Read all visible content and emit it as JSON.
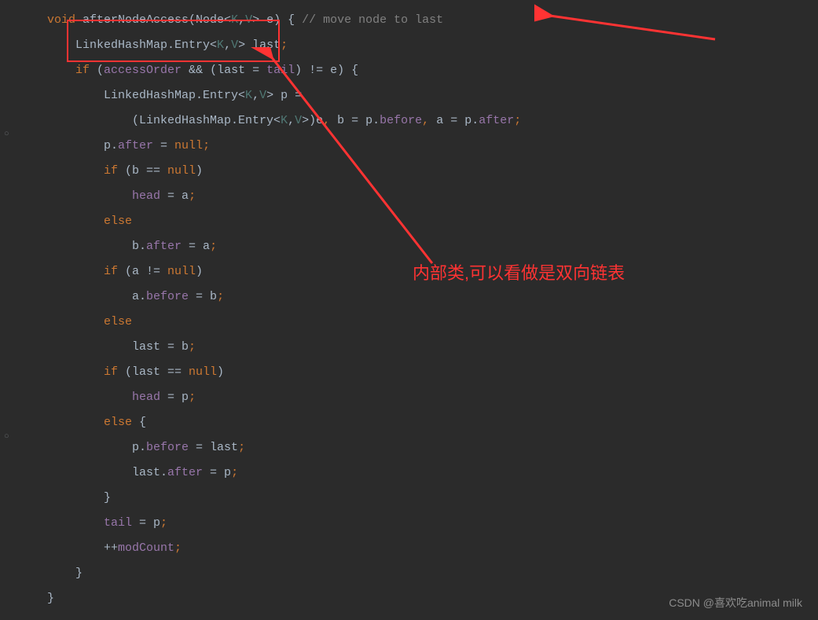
{
  "code": {
    "l1_kw": "void",
    "l1_name": " afterNodeAccess(Node<",
    "l1_g1": "K",
    "l1_c1": ",",
    "l1_g2": "V",
    "l1_rest": "> e) { ",
    "l1_comment": "// move node to last",
    "l2_a": "    LinkedHashMap.Entry<",
    "l2_g1": "K",
    "l2_c1": ",",
    "l2_g2": "V",
    "l2_b": "> last",
    "l2_semi": ";",
    "l3_if": "    if",
    "l3_a": " (",
    "l3_accessOrder": "accessOrder",
    "l3_b": " && (last = ",
    "l3_tail": "tail",
    "l3_c": ") != e) {",
    "l4_a": "        LinkedHashMap.Entry<",
    "l4_g1": "K",
    "l4_c1": ",",
    "l4_g2": "V",
    "l4_b": "> p =",
    "l5_a": "            (LinkedHashMap.Entry<",
    "l5_g1": "K",
    "l5_c1": ",",
    "l5_g2": "V",
    "l5_b": ">)e",
    "l5_c": ", ",
    "l5_d": "b = p.",
    "l5_before": "before",
    "l5_e": ", ",
    "l5_f": "a = p.",
    "l5_after": "after",
    "l5_semi": ";",
    "l6_a": "        p.",
    "l6_after": "after",
    "l6_b": " = ",
    "l6_null": "null",
    "l6_semi": ";",
    "l7_if": "        if",
    "l7_a": " (b == ",
    "l7_null": "null",
    "l7_b": ")",
    "l8_a": "            ",
    "l8_head": "head",
    "l8_b": " = a",
    "l8_semi": ";",
    "l9_else": "        else",
    "l10_a": "            b.",
    "l10_after": "after",
    "l10_b": " = a",
    "l10_semi": ";",
    "l11_if": "        if",
    "l11_a": " (a != ",
    "l11_null": "null",
    "l11_b": ")",
    "l12_a": "            a.",
    "l12_before": "before",
    "l12_b": " = b",
    "l12_semi": ";",
    "l13_else": "        else",
    "l14_a": "            last = b",
    "l14_semi": ";",
    "l15_if": "        if",
    "l15_a": " (last == ",
    "l15_null": "null",
    "l15_b": ")",
    "l16_a": "            ",
    "l16_head": "head",
    "l16_b": " = p",
    "l16_semi": ";",
    "l17_else": "        else",
    "l17_a": " {",
    "l18_a": "            p.",
    "l18_before": "before",
    "l18_b": " = last",
    "l18_semi": ";",
    "l19_a": "            last.",
    "l19_after": "after",
    "l19_b": " = p",
    "l19_semi": ";",
    "l20_a": "        }",
    "l21_a": "        ",
    "l21_tail": "tail",
    "l21_b": " = p",
    "l21_semi": ";",
    "l22_a": "        ++",
    "l22_modCount": "modCount",
    "l22_semi": ";",
    "l23_a": "    }",
    "l24_a": "}"
  },
  "annotation_text": "内部类,可以看做是双向链表",
  "watermark": "CSDN @喜欢吃animal milk"
}
